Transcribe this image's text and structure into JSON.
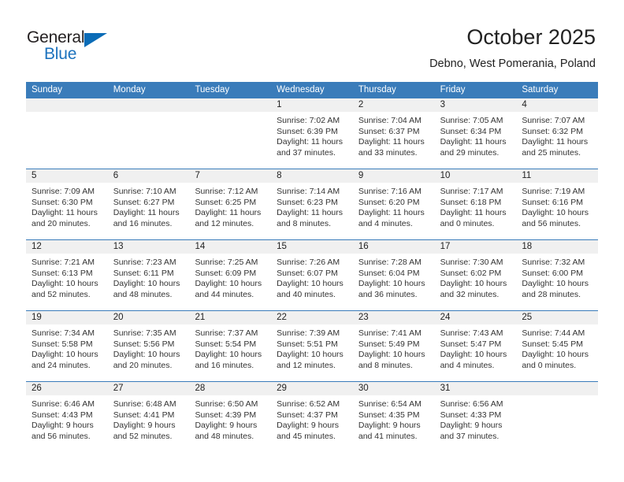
{
  "header": {
    "logo": {
      "word1": "General",
      "word2": "Blue",
      "triangle_color": "#0b6cb7",
      "word1_color": "#231f20",
      "word2_color": "#1c72bd"
    },
    "title": "October 2025",
    "subtitle": "Debno, West Pomerania, Poland"
  },
  "theme": {
    "header_band": "#3a7cba",
    "date_band": "#f0f0f0",
    "text": "#333333"
  },
  "calendar": {
    "weekdays": [
      "Sunday",
      "Monday",
      "Tuesday",
      "Wednesday",
      "Thursday",
      "Friday",
      "Saturday"
    ],
    "weeks": [
      [
        {
          "day": "",
          "sunrise": "",
          "sunset": "",
          "daylight1": "",
          "daylight2": ""
        },
        {
          "day": "",
          "sunrise": "",
          "sunset": "",
          "daylight1": "",
          "daylight2": ""
        },
        {
          "day": "",
          "sunrise": "",
          "sunset": "",
          "daylight1": "",
          "daylight2": ""
        },
        {
          "day": "1",
          "sunrise": "Sunrise: 7:02 AM",
          "sunset": "Sunset: 6:39 PM",
          "daylight1": "Daylight: 11 hours",
          "daylight2": "and 37 minutes."
        },
        {
          "day": "2",
          "sunrise": "Sunrise: 7:04 AM",
          "sunset": "Sunset: 6:37 PM",
          "daylight1": "Daylight: 11 hours",
          "daylight2": "and 33 minutes."
        },
        {
          "day": "3",
          "sunrise": "Sunrise: 7:05 AM",
          "sunset": "Sunset: 6:34 PM",
          "daylight1": "Daylight: 11 hours",
          "daylight2": "and 29 minutes."
        },
        {
          "day": "4",
          "sunrise": "Sunrise: 7:07 AM",
          "sunset": "Sunset: 6:32 PM",
          "daylight1": "Daylight: 11 hours",
          "daylight2": "and 25 minutes."
        }
      ],
      [
        {
          "day": "5",
          "sunrise": "Sunrise: 7:09 AM",
          "sunset": "Sunset: 6:30 PM",
          "daylight1": "Daylight: 11 hours",
          "daylight2": "and 20 minutes."
        },
        {
          "day": "6",
          "sunrise": "Sunrise: 7:10 AM",
          "sunset": "Sunset: 6:27 PM",
          "daylight1": "Daylight: 11 hours",
          "daylight2": "and 16 minutes."
        },
        {
          "day": "7",
          "sunrise": "Sunrise: 7:12 AM",
          "sunset": "Sunset: 6:25 PM",
          "daylight1": "Daylight: 11 hours",
          "daylight2": "and 12 minutes."
        },
        {
          "day": "8",
          "sunrise": "Sunrise: 7:14 AM",
          "sunset": "Sunset: 6:23 PM",
          "daylight1": "Daylight: 11 hours",
          "daylight2": "and 8 minutes."
        },
        {
          "day": "9",
          "sunrise": "Sunrise: 7:16 AM",
          "sunset": "Sunset: 6:20 PM",
          "daylight1": "Daylight: 11 hours",
          "daylight2": "and 4 minutes."
        },
        {
          "day": "10",
          "sunrise": "Sunrise: 7:17 AM",
          "sunset": "Sunset: 6:18 PM",
          "daylight1": "Daylight: 11 hours",
          "daylight2": "and 0 minutes."
        },
        {
          "day": "11",
          "sunrise": "Sunrise: 7:19 AM",
          "sunset": "Sunset: 6:16 PM",
          "daylight1": "Daylight: 10 hours",
          "daylight2": "and 56 minutes."
        }
      ],
      [
        {
          "day": "12",
          "sunrise": "Sunrise: 7:21 AM",
          "sunset": "Sunset: 6:13 PM",
          "daylight1": "Daylight: 10 hours",
          "daylight2": "and 52 minutes."
        },
        {
          "day": "13",
          "sunrise": "Sunrise: 7:23 AM",
          "sunset": "Sunset: 6:11 PM",
          "daylight1": "Daylight: 10 hours",
          "daylight2": "and 48 minutes."
        },
        {
          "day": "14",
          "sunrise": "Sunrise: 7:25 AM",
          "sunset": "Sunset: 6:09 PM",
          "daylight1": "Daylight: 10 hours",
          "daylight2": "and 44 minutes."
        },
        {
          "day": "15",
          "sunrise": "Sunrise: 7:26 AM",
          "sunset": "Sunset: 6:07 PM",
          "daylight1": "Daylight: 10 hours",
          "daylight2": "and 40 minutes."
        },
        {
          "day": "16",
          "sunrise": "Sunrise: 7:28 AM",
          "sunset": "Sunset: 6:04 PM",
          "daylight1": "Daylight: 10 hours",
          "daylight2": "and 36 minutes."
        },
        {
          "day": "17",
          "sunrise": "Sunrise: 7:30 AM",
          "sunset": "Sunset: 6:02 PM",
          "daylight1": "Daylight: 10 hours",
          "daylight2": "and 32 minutes."
        },
        {
          "day": "18",
          "sunrise": "Sunrise: 7:32 AM",
          "sunset": "Sunset: 6:00 PM",
          "daylight1": "Daylight: 10 hours",
          "daylight2": "and 28 minutes."
        }
      ],
      [
        {
          "day": "19",
          "sunrise": "Sunrise: 7:34 AM",
          "sunset": "Sunset: 5:58 PM",
          "daylight1": "Daylight: 10 hours",
          "daylight2": "and 24 minutes."
        },
        {
          "day": "20",
          "sunrise": "Sunrise: 7:35 AM",
          "sunset": "Sunset: 5:56 PM",
          "daylight1": "Daylight: 10 hours",
          "daylight2": "and 20 minutes."
        },
        {
          "day": "21",
          "sunrise": "Sunrise: 7:37 AM",
          "sunset": "Sunset: 5:54 PM",
          "daylight1": "Daylight: 10 hours",
          "daylight2": "and 16 minutes."
        },
        {
          "day": "22",
          "sunrise": "Sunrise: 7:39 AM",
          "sunset": "Sunset: 5:51 PM",
          "daylight1": "Daylight: 10 hours",
          "daylight2": "and 12 minutes."
        },
        {
          "day": "23",
          "sunrise": "Sunrise: 7:41 AM",
          "sunset": "Sunset: 5:49 PM",
          "daylight1": "Daylight: 10 hours",
          "daylight2": "and 8 minutes."
        },
        {
          "day": "24",
          "sunrise": "Sunrise: 7:43 AM",
          "sunset": "Sunset: 5:47 PM",
          "daylight1": "Daylight: 10 hours",
          "daylight2": "and 4 minutes."
        },
        {
          "day": "25",
          "sunrise": "Sunrise: 7:44 AM",
          "sunset": "Sunset: 5:45 PM",
          "daylight1": "Daylight: 10 hours",
          "daylight2": "and 0 minutes."
        }
      ],
      [
        {
          "day": "26",
          "sunrise": "Sunrise: 6:46 AM",
          "sunset": "Sunset: 4:43 PM",
          "daylight1": "Daylight: 9 hours",
          "daylight2": "and 56 minutes."
        },
        {
          "day": "27",
          "sunrise": "Sunrise: 6:48 AM",
          "sunset": "Sunset: 4:41 PM",
          "daylight1": "Daylight: 9 hours",
          "daylight2": "and 52 minutes."
        },
        {
          "day": "28",
          "sunrise": "Sunrise: 6:50 AM",
          "sunset": "Sunset: 4:39 PM",
          "daylight1": "Daylight: 9 hours",
          "daylight2": "and 48 minutes."
        },
        {
          "day": "29",
          "sunrise": "Sunrise: 6:52 AM",
          "sunset": "Sunset: 4:37 PM",
          "daylight1": "Daylight: 9 hours",
          "daylight2": "and 45 minutes."
        },
        {
          "day": "30",
          "sunrise": "Sunrise: 6:54 AM",
          "sunset": "Sunset: 4:35 PM",
          "daylight1": "Daylight: 9 hours",
          "daylight2": "and 41 minutes."
        },
        {
          "day": "31",
          "sunrise": "Sunrise: 6:56 AM",
          "sunset": "Sunset: 4:33 PM",
          "daylight1": "Daylight: 9 hours",
          "daylight2": "and 37 minutes."
        },
        {
          "day": "",
          "sunrise": "",
          "sunset": "",
          "daylight1": "",
          "daylight2": ""
        }
      ]
    ]
  }
}
